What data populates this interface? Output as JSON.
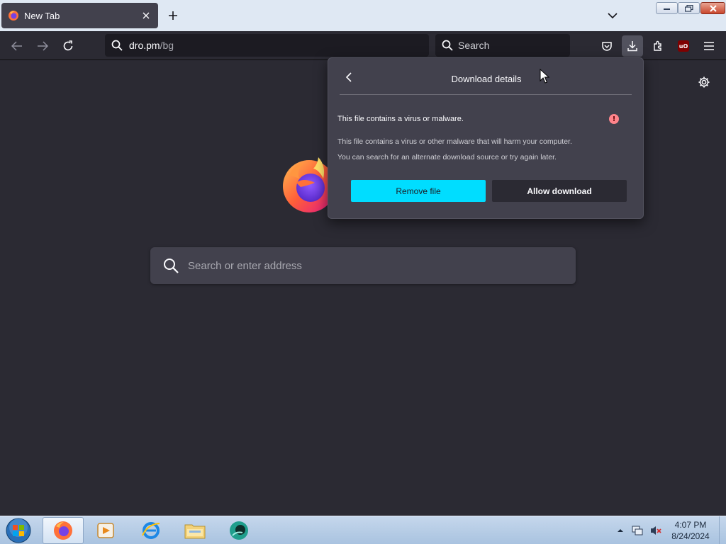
{
  "browser": {
    "tab": {
      "title": "New Tab"
    },
    "url": {
      "host": "dro.pm",
      "path": "/bg"
    },
    "search_placeholder": "Search"
  },
  "newtab": {
    "search_placeholder": "Search or enter address"
  },
  "download_panel": {
    "title": "Download details",
    "heading": "This file contains a virus or malware.",
    "description_line1": "This file contains a virus or other malware that will harm your computer.",
    "description_line2": "You can search for an alternate download source or try again later.",
    "remove_label": "Remove file",
    "allow_label": "Allow download",
    "warning_glyph": "!"
  },
  "toolbar": {
    "ublock_label": "uO"
  },
  "taskbar": {
    "time": "4:07 PM",
    "date": "8/24/2024",
    "items": [
      "firefox-icon",
      "media-player-icon",
      "internet-explorer-icon",
      "file-explorer-icon",
      "chat-app-icon"
    ]
  },
  "colors": {
    "accent": "#00ddff",
    "panel_bg": "#42414d",
    "page_bg": "#2b2a33",
    "warning": "#ff848b"
  }
}
